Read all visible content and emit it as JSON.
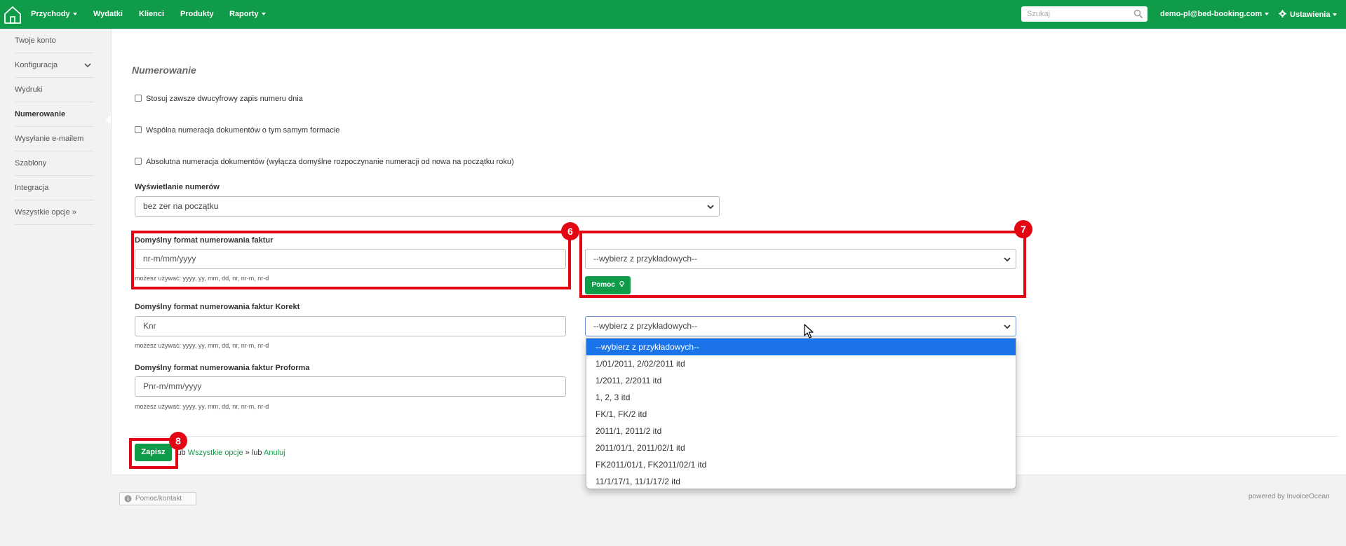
{
  "brand_color": "#0f9b48",
  "annotation_color": "#e30613",
  "topnav": {
    "items": [
      {
        "label": "Przychody",
        "has_dropdown": true
      },
      {
        "label": "Wydatki",
        "has_dropdown": false
      },
      {
        "label": "Klienci",
        "has_dropdown": false
      },
      {
        "label": "Produkty",
        "has_dropdown": false
      },
      {
        "label": "Raporty",
        "has_dropdown": true
      }
    ],
    "search_placeholder": "Szukaj",
    "user": "demo-pl@bed-booking.com",
    "settings": "Ustawienia"
  },
  "sidebar": {
    "items": [
      {
        "label": "Twoje konto"
      },
      {
        "label": "Konfiguracja"
      },
      {
        "label": "Wydruki"
      },
      {
        "label": "Numerowanie"
      },
      {
        "label": "Wysyłanie e-mailem"
      },
      {
        "label": "Szablony"
      },
      {
        "label": "Integracja"
      },
      {
        "label": "Wszystkie opcje »"
      }
    ],
    "active": "Numerowanie"
  },
  "form": {
    "title": "Numerowanie",
    "checkboxes": [
      {
        "label": "Stosuj zawsze dwucyfrowy zapis numeru dnia",
        "checked": false
      },
      {
        "label": "Wspólna numeracja dokumentów o tym samym formacie",
        "checked": false
      },
      {
        "label": "Absolutna numeracja dokumentów (wyłącza domyślne rozpoczynanie numeracji od nowa na początku roku)",
        "checked": false
      }
    ],
    "display": {
      "label": "Wyświetlanie numerów",
      "value": "bez zer na początku"
    },
    "invoice_format": {
      "label": "Domyślny format numerowania faktur",
      "value": "nr-m/mm/yyyy",
      "hint": "możesz używać: yyyy, yy, mm, dd, nr, nr-m, nr-d",
      "example_select": "--wybierz z przykładowych--"
    },
    "correction_format": {
      "label": "Domyślny format numerowania faktur Korekt",
      "value": "Knr",
      "hint": "możesz używać: yyyy, yy, mm, dd, nr, nr-m, nr-d",
      "example_select": "--wybierz z przykładowych--"
    },
    "proforma_format": {
      "label": "Domyślny format numerowania faktur Proforma",
      "value": "Pnr-m/mm/yyyy",
      "hint": "możesz używać: yyyy, yy, mm, dd, nr, nr-m, nr-d"
    },
    "help_button": "Pomoc",
    "save_button": "Zapisz",
    "footer": {
      "or1": "lub",
      "all_options": "Wszystkie opcje",
      "sep": "»",
      "or2": "lub",
      "cancel": "Anuluj"
    }
  },
  "dropdown": {
    "options": [
      "--wybierz z przykładowych--",
      "1/01/2011, 2/02/2011 itd",
      "1/2011, 2/2011 itd",
      "1, 2, 3 itd",
      "FK/1, FK/2 itd",
      "2011/1, 2011/2 itd",
      "2011/01/1, 2011/02/1 itd",
      "FK2011/01/1, FK2011/02/1 itd",
      "11/1/17/1, 11/1/17/2 itd"
    ],
    "selected_index": 0
  },
  "annotations": [
    "6",
    "7",
    "8"
  ],
  "page_footer": {
    "help": "Pomoc/kontakt",
    "powered": "powered by InvoiceOcean"
  }
}
